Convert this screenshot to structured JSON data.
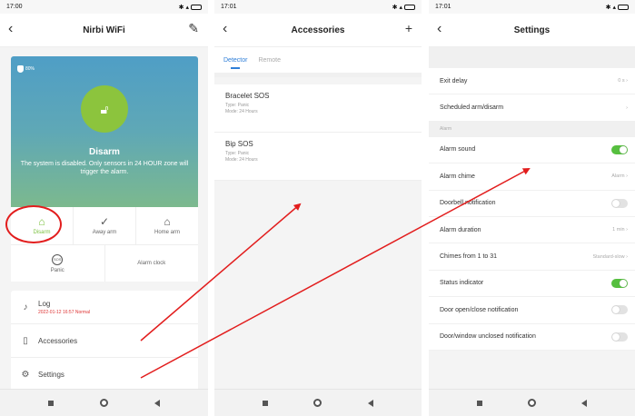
{
  "colors": {
    "accent_green": "#7cc241",
    "toggle_on": "#56bf3f",
    "tab_blue": "#2f7fd8",
    "annotation_red": "#e21d1d"
  },
  "home": {
    "status_time": "17:00",
    "title": "Nirbi WiFi",
    "battery_label": "80%",
    "state": "Disarm",
    "state_desc": "The system is disabled. Only sensors in 24 HOUR zone will trigger the alarm.",
    "modes": [
      {
        "label": "Disarm",
        "icon": "unlock-icon"
      },
      {
        "label": "Away arm",
        "icon": "shield-check-icon"
      },
      {
        "label": "Home arm",
        "icon": "home-icon"
      }
    ],
    "panic_label": "Panic",
    "sos_icon_text": "SOS",
    "alarm_clock_label": "Alarm clock",
    "log_label": "Log",
    "log_entry": "2022-01-12 16:57 Normal",
    "accessories_label": "Accessories",
    "settings_label": "Settings"
  },
  "accessories": {
    "status_time": "17:01",
    "title": "Accessories",
    "tabs": [
      "Detector",
      "Remote"
    ],
    "items": [
      {
        "name": "Bracelet SOS",
        "type": "Type: Panic",
        "mode": "Mode: 24 Hours"
      },
      {
        "name": "Bip SOS",
        "type": "Type: Panic",
        "mode": "Mode: 24 Hours"
      }
    ]
  },
  "settings": {
    "status_time": "17:01",
    "title": "Settings",
    "exit_delay_label": "Exit delay",
    "exit_delay_value": "0 s",
    "scheduled_label": "Scheduled arm/disarm",
    "section_alarm": "Alarm",
    "rows": [
      {
        "label": "Alarm sound",
        "toggle": true
      },
      {
        "label": "Alarm chime",
        "value": "Alarm"
      },
      {
        "label": "Doorbell notification",
        "toggle": false
      },
      {
        "label": "Alarm duration",
        "value": "1 min"
      },
      {
        "label": "Chimes from 1 to 31",
        "value": "Standard-slow"
      },
      {
        "label": "Status indicator",
        "toggle": true
      },
      {
        "label": "Door open/close notification",
        "toggle": false
      },
      {
        "label": "Door/window unclosed notification",
        "toggle": false
      }
    ]
  }
}
